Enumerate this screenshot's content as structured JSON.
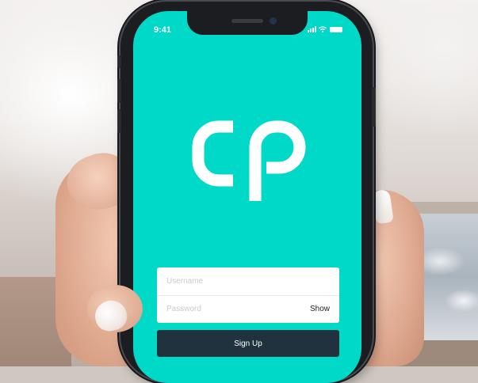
{
  "status_bar": {
    "time": "9:41"
  },
  "brand": {
    "logo_text": "CP",
    "accent_color": "#00d8c8",
    "logo_color": "#ffffff"
  },
  "form": {
    "username_placeholder": "Username",
    "password_placeholder": "Password",
    "show_label": "Show",
    "submit_label": "Sign Up",
    "button_color": "#21323f"
  },
  "icons": [
    "signal-icon",
    "wifi-icon",
    "battery-icon",
    "camera-icon"
  ]
}
